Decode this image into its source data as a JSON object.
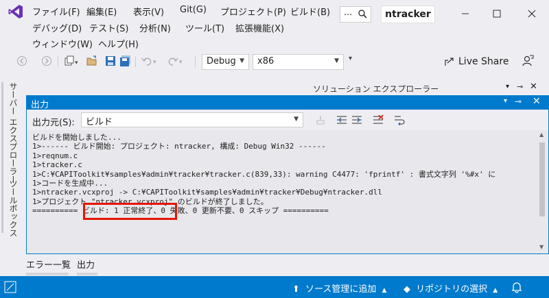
{
  "menu": {
    "row1": [
      "ファイル(F)",
      "編集(E)",
      "表示(V)",
      "Git(G)",
      "プロジェクト(P)",
      "ビルド(B)"
    ],
    "row2": [
      "デバッグ(D)",
      "テスト(S)",
      "分析(N)",
      "ツール(T)",
      "拡張機能(X)"
    ],
    "row3": [
      "ウィンドウ(W)",
      "ヘルプ(H)"
    ],
    "search_label": "...",
    "solution_name": "ntracker"
  },
  "toolbar": {
    "config": "Debug",
    "platform": "x86",
    "live_share": "Live Share"
  },
  "side_tabs": [
    "サーバー エクスプローラー",
    "ツールボックス"
  ],
  "solution_explorer_title": "ソリューション エクスプローラー",
  "output": {
    "title": "出力",
    "source_label": "出力元(S):",
    "source_value": "ビルド",
    "lines": [
      "ビルドを開始しました...",
      "1>------ ビルド開始: プロジェクト: ntracker, 構成: Debug Win32 ------",
      "1>reqnum.c",
      "1>tracker.c",
      "1>C:¥CAPIToolkit¥samples¥admin¥tracker¥tracker.c(839,33): warning C4477: 'fprintf' : 書式文字列 '%#x' に",
      "1>コードを生成中...",
      "1>ntracker.vcxproj -> C:¥CAPIToolkit¥samples¥admin¥tracker¥Debug¥ntracker.dll",
      "1>プロジェクト \"ntracker.vcxproj\" のビルドが終了しました。",
      "========== ビルド: 1 正常終了、0 失敗、0 更新不要、0 スキップ =========="
    ]
  },
  "bottom_tabs": [
    "エラー一覧",
    "出力"
  ],
  "status": {
    "source_control": "ソース管理に追加",
    "repo": "リポジトリの選択"
  },
  "colors": {
    "accent": "#007acc",
    "panel_bg": "#e8e8ec",
    "highlight": "#e51400"
  }
}
